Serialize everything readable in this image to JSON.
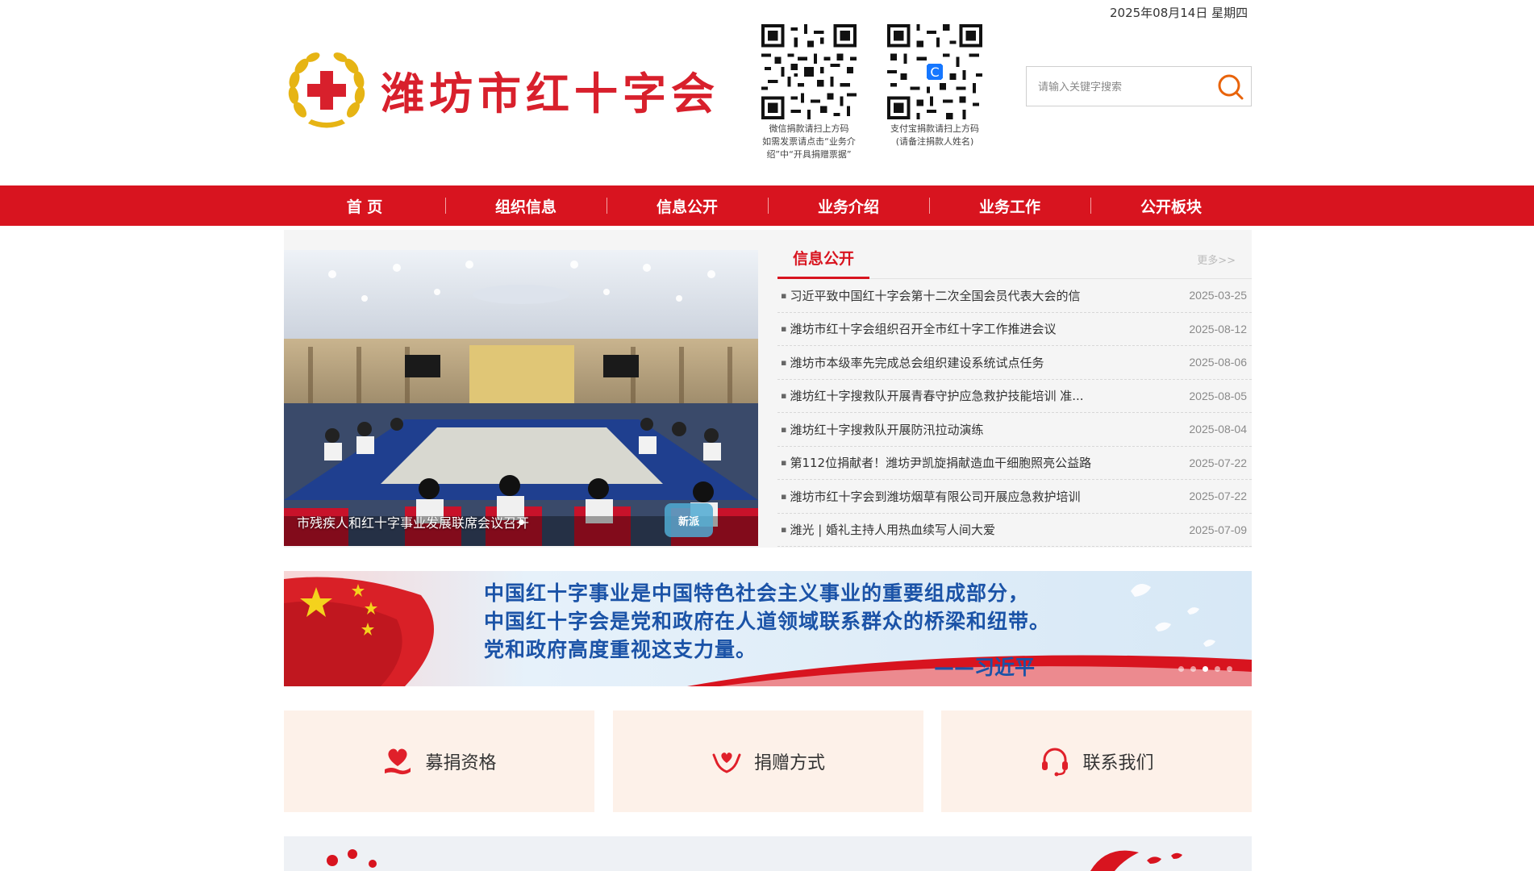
{
  "header": {
    "date": "2025年08月14日 星期四",
    "logo_text": "潍坊市红十字会",
    "qr_codes": [
      {
        "caption": "微信捐款请扫上方码\n如需发票请点击“业务介\n绍”中“开具捐赠票据”"
      },
      {
        "caption": "支付宝捐款请扫上方码\n(请备注捐款人姓名)"
      }
    ],
    "search": {
      "placeholder": "请输入关键字搜索",
      "icon": "search-icon"
    }
  },
  "nav": {
    "items": [
      {
        "label": "首  页"
      },
      {
        "label": "组织信息"
      },
      {
        "label": "信息公开"
      },
      {
        "label": "业务介绍"
      },
      {
        "label": "业务工作"
      },
      {
        "label": "公开板块"
      }
    ]
  },
  "slider": {
    "caption": "市残疾人和红十字事业发展联席会议召开",
    "watermark": "新派"
  },
  "news": {
    "tab": "信息公开",
    "more": "更多>>",
    "items": [
      {
        "title": "习近平致中国红十字会第十二次全国会员代表大会的信",
        "date": "2025-03-25"
      },
      {
        "title": "潍坊市红十字会组织召开全市红十字工作推进会议",
        "date": "2025-08-12"
      },
      {
        "title": "潍坊市本级率先完成总会组织建设系统试点任务",
        "date": "2025-08-06"
      },
      {
        "title": "潍坊红十字搜救队开展青春守护应急救护技能培训 准...",
        "date": "2025-08-05"
      },
      {
        "title": "潍坊红十字搜救队开展防汛拉动演练",
        "date": "2025-08-04"
      },
      {
        "title": "第112位捐献者！潍坊尹凯旋捐献造血干细胞照亮公益路",
        "date": "2025-07-22"
      },
      {
        "title": "潍坊市红十字会到潍坊烟草有限公司开展应急救护培训",
        "date": "2025-07-22"
      },
      {
        "title": "潍光 | 婚礼主持人用热血续写人间大爱",
        "date": "2025-07-09"
      }
    ]
  },
  "banner": {
    "lines": [
      "中国红十字事业是中国特色社会主义事业的重要组成部分，",
      "中国红十字会是党和政府在人道领域联系群众的桥梁和纽带。",
      "党和政府高度重视这支力量。"
    ],
    "signature": "——习近平"
  },
  "quick_links": [
    {
      "label": "募捐资格",
      "icon": "heart-hand-icon"
    },
    {
      "label": "捐赠方式",
      "icon": "hands-heart-icon"
    },
    {
      "label": "联系我们",
      "icon": "headset-icon"
    }
  ],
  "colors": {
    "brand_red": "#d8141f",
    "banner_blue": "#1b53a7",
    "card_bg": "#fdf1e9"
  }
}
